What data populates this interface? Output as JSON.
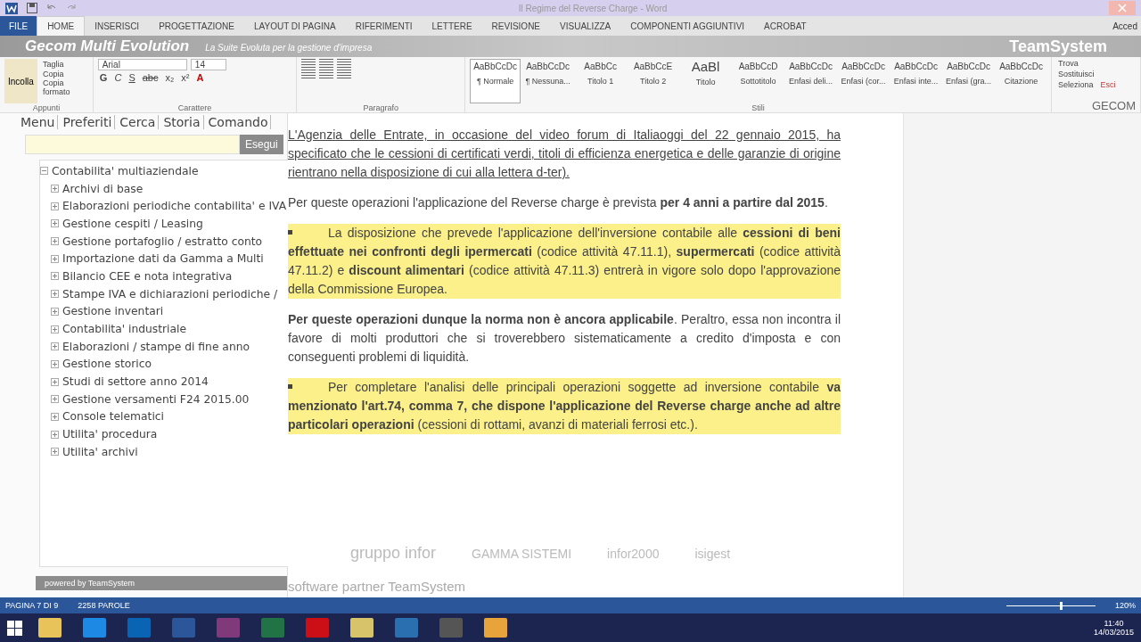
{
  "window": {
    "title": "Il Regime del Reverse Charge - Word",
    "account": "Acced"
  },
  "tabs": [
    {
      "label": "FILE",
      "kind": "file",
      "selected": false
    },
    {
      "label": "HOME",
      "kind": "tab",
      "selected": true
    },
    {
      "label": "INSERISCI",
      "kind": "tab",
      "selected": false
    },
    {
      "label": "PROGETTAZIONE",
      "kind": "tab",
      "selected": false
    },
    {
      "label": "LAYOUT DI PAGINA",
      "kind": "tab",
      "selected": false
    },
    {
      "label": "RIFERIMENTI",
      "kind": "tab",
      "selected": false
    },
    {
      "label": "LETTERE",
      "kind": "tab",
      "selected": false
    },
    {
      "label": "REVISIONE",
      "kind": "tab",
      "selected": false
    },
    {
      "label": "VISUALIZZA",
      "kind": "tab",
      "selected": false
    },
    {
      "label": "COMPONENTI AGGIUNTIVI",
      "kind": "tab",
      "selected": false
    },
    {
      "label": "ACROBAT",
      "kind": "tab",
      "selected": false
    }
  ],
  "banner": {
    "title": "Gecom Multi Evolution",
    "subtitle": "La Suite Evoluta per la gestione d'impresa",
    "brand": "TeamSystem"
  },
  "ribbon": {
    "clipboard": {
      "paste": "Incolla",
      "cut": "Taglia",
      "copy": "Copia",
      "format_painter": "Copia formato",
      "label": "Appunti"
    },
    "font": {
      "family": "Arial",
      "size": "14",
      "label": "Carattere",
      "format_buttons": [
        {
          "label": "G"
        },
        {
          "label": "C"
        },
        {
          "label": "S"
        },
        {
          "label": "abc"
        },
        {
          "label": "x₂"
        },
        {
          "label": "x²"
        },
        {
          "label": "A"
        }
      ]
    },
    "paragraph": {
      "label": "Paragrafo"
    },
    "styles": {
      "label": "Stili",
      "items": [
        {
          "preview": "AaBbCcDc",
          "name": "¶ Normale",
          "selected": true
        },
        {
          "preview": "AaBbCcDc",
          "name": "¶ Nessuna...",
          "selected": false
        },
        {
          "preview": "AaBbCc",
          "name": "Titolo 1",
          "selected": false
        },
        {
          "preview": "AaBbCcE",
          "name": "Titolo 2",
          "selected": false
        },
        {
          "preview": "AaBl",
          "name": "Titolo",
          "selected": false
        },
        {
          "preview": "AaBbCcD",
          "name": "Sottotitolo",
          "selected": false
        },
        {
          "preview": "AaBbCcDc",
          "name": "Enfasi deli...",
          "selected": false
        },
        {
          "preview": "AaBbCcDc",
          "name": "Enfasi (cor...",
          "selected": false
        },
        {
          "preview": "AaBbCcDc",
          "name": "Enfasi inte...",
          "selected": false
        },
        {
          "preview": "AaBbCcDc",
          "name": "Enfasi (gra...",
          "selected": false
        },
        {
          "preview": "AaBbCcDc",
          "name": "Citazione",
          "selected": false
        }
      ]
    },
    "editing": {
      "find": "Trova",
      "replace": "Sostituisci",
      "select": "Seleziona",
      "exit": "Esci",
      "label": "GECOM"
    }
  },
  "gecom": {
    "menu": [
      {
        "label": "Menu"
      },
      {
        "label": "Preferiti"
      },
      {
        "label": "Cerca"
      },
      {
        "label": "Storia"
      },
      {
        "label": "Comando"
      }
    ],
    "run_button": "Esegui",
    "tree": {
      "label": "Contabilita' multiaziendale",
      "expanded": true,
      "children": [
        {
          "label": "Archivi di base",
          "expanded": false
        },
        {
          "label": "Elaborazioni periodiche contabilita' e IVA",
          "expanded": false
        },
        {
          "label": "Gestione cespiti / Leasing",
          "expanded": false
        },
        {
          "label": "Gestione portafoglio / estratto conto",
          "expanded": false
        },
        {
          "label": "Importazione dati da Gamma a Multi",
          "expanded": false
        },
        {
          "label": "Bilancio CEE e nota integrativa",
          "expanded": false
        },
        {
          "label": "Stampe IVA e dichiarazioni periodiche /",
          "expanded": false
        },
        {
          "label": "Gestione inventari",
          "expanded": false
        },
        {
          "label": "Contabilita' industriale",
          "expanded": false
        },
        {
          "label": "Elaborazioni / stampe di fine anno",
          "expanded": false
        },
        {
          "label": "Gestione storico",
          "expanded": false
        },
        {
          "label": "Studi di settore anno 2014",
          "expanded": false
        },
        {
          "label": "Gestione versamenti F24 2015.00",
          "expanded": false
        },
        {
          "label": "Console telematici",
          "expanded": false
        },
        {
          "label": "Utilita' procedura",
          "expanded": false
        },
        {
          "label": "Utilita' archivi",
          "expanded": false
        }
      ]
    },
    "powered_by": "powered by TeamSystem"
  },
  "document": {
    "paragraphs": [
      {
        "kind": "underlined",
        "highlighted": false,
        "text": "L'Agenzia delle Entrate, in occasione del video forum di Italiaoggi del 22 gennaio 2015, ha specificato che le cessioni di certificati verdi, titoli di efficienza energetica e delle garanzie di origine rientrano nella disposizione di cui alla lettera d-ter)."
      },
      {
        "kind": "plain",
        "highlighted": false,
        "text": "Per queste operazioni l'applicazione del Reverse charge è prevista **per 4 anni a partire dal 2015**."
      },
      {
        "kind": "bullet",
        "highlighted": true,
        "text": "La disposizione che prevede l'applicazione dell'inversione contabile alle **cessioni di beni effettuate nei confronti degli ipermercati** (codice attività 47.11.1), **supermercati** (codice attività 47.11.2) e **discount alimentari** (codice attività 47.11.3) entrerà in vigore solo dopo l'approvazione della Commissione Europea."
      },
      {
        "kind": "plain",
        "highlighted": false,
        "text": "**Per queste operazioni dunque la norma non è ancora applicabile**. Peraltro, essa non incontra il favore di molti produttori che si troverebbero sistematicamente a credito d'imposta e con conseguenti problemi di liquidità."
      },
      {
        "kind": "bullet",
        "highlighted": true,
        "text": "Per completare l'analisi delle principali operazioni soggette ad inversione contabile **va menzionato l'art.74, comma 7, che dispone l'applicazione del Reverse charge anche ad altre particolari operazioni** (cessioni di rottami, avanzi di materiali ferrosi etc.)."
      }
    ]
  },
  "partners": [
    {
      "text": "gruppo infor"
    },
    {
      "text": "GAMMA SISTEMI"
    },
    {
      "text": "infor2000"
    },
    {
      "text": "isigest"
    }
  ],
  "software_partner": "software partner TeamSystem",
  "status_bar": {
    "page": "PAGINA 7 DI 9",
    "words": "2258 PAROLE",
    "zoom": "120%",
    "zoom_level": {
      "level": 0.6
    }
  },
  "taskbar": {
    "time": "11:40",
    "date": "14/03/2015"
  }
}
